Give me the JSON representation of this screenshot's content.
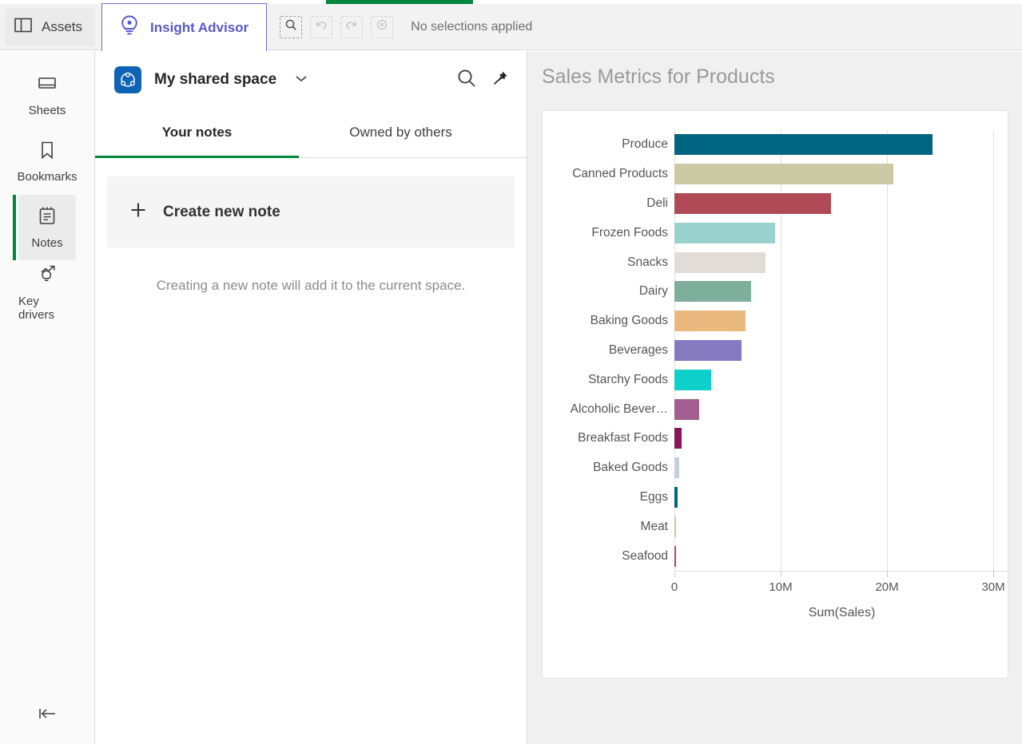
{
  "topbar": {
    "assets_label": "Assets",
    "assets_icon": "panel-layout-icon",
    "insight_advisor_label": "Insight Advisor",
    "insight_advisor_icon": "lightbulb-eye-icon",
    "tools": [
      {
        "name": "smart-search",
        "icon": "magnifier-icon",
        "enabled": true
      },
      {
        "name": "undo",
        "icon": "undo-arrow-icon",
        "enabled": false
      },
      {
        "name": "redo",
        "icon": "redo-arrow-icon",
        "enabled": false
      },
      {
        "name": "clear-selections",
        "icon": "circle-x-icon",
        "enabled": false
      }
    ],
    "selection_status": "No selections applied",
    "accent_purple": "#6E6BD8",
    "accent_green": "#00873D"
  },
  "sidebar": {
    "items": [
      {
        "label": "Sheets",
        "icon": "sheet-icon",
        "active": false
      },
      {
        "label": "Bookmarks",
        "icon": "bookmark-icon",
        "active": false
      },
      {
        "label": "Notes",
        "icon": "notepad-icon",
        "active": true
      },
      {
        "label": "Key drivers",
        "icon": "lightbulb-trend-icon",
        "active": false
      }
    ],
    "collapse_icon": "collapse-left-icon"
  },
  "notes_panel": {
    "space_name": "My shared space",
    "space_icon": "shared-space-icon",
    "space_icon_color": "#0F63B4",
    "dropdown_icon": "chevron-down-icon",
    "search_icon": "search-icon",
    "pin_icon": "pin-icon",
    "tabs": [
      {
        "label": "Your notes",
        "active": true
      },
      {
        "label": "Owned by others",
        "active": false
      }
    ],
    "create_note_label": "Create new note",
    "create_note_icon": "plus-icon",
    "hint": "Creating a new note will add it to the current space."
  },
  "chart_data": {
    "type": "bar",
    "orientation": "horizontal",
    "title": "Sales Metrics for Products",
    "xlabel": "Sum(Sales)",
    "ylabel": "",
    "xlim": [
      0,
      31500000
    ],
    "xticks": [
      0,
      10000000,
      20000000,
      30000000
    ],
    "xticklabels": [
      "0",
      "10M",
      "20M",
      "30M"
    ],
    "grid": true,
    "legend": "none",
    "categories": [
      "Produce",
      "Canned Products",
      "Deli",
      "Frozen Foods",
      "Snacks",
      "Dairy",
      "Baking Goods",
      "Beverages",
      "Starchy Foods",
      "Alcoholic Bever…",
      "Breakfast Foods",
      "Baked Goods",
      "Eggs",
      "Meat",
      "Seafood"
    ],
    "values": [
      24300000,
      20600000,
      14700000,
      9500000,
      8600000,
      7200000,
      6700000,
      6300000,
      3450000,
      2300000,
      700000,
      420000,
      300000,
      60000,
      50000
    ],
    "colors": [
      "#006580",
      "#CCC9A5",
      "#B04A56",
      "#99D2CD",
      "#E2DCD8",
      "#7DAF9C",
      "#E8B87F",
      "#8579C0",
      "#0FCFCB",
      "#A25E8E",
      "#8C1558",
      "#C5CFDC",
      "#006580",
      "#CCC9A5",
      "#B04A56"
    ]
  }
}
